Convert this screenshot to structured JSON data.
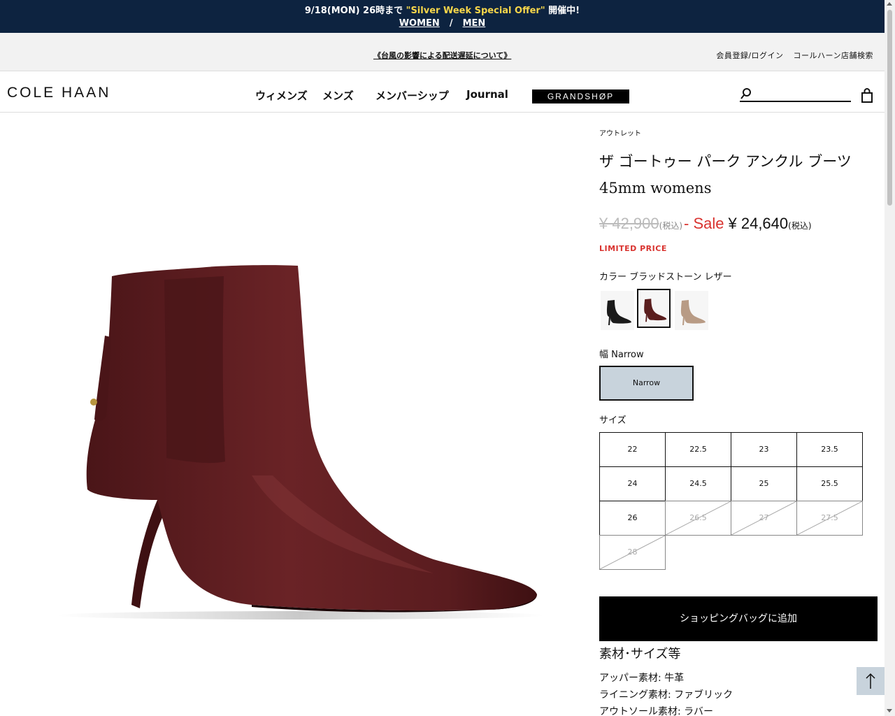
{
  "promo": {
    "line1_prefix": "9/18(MON) 26時まで ",
    "line1_highlight": "\"Silver Week Special Offer\"",
    "line1_suffix": " 開催中!",
    "women": "WOMEN",
    "separator": "/",
    "men": "MEN"
  },
  "notice": {
    "delivery_link": "《台風の影響による配送遅延について》",
    "login": "会員登録/ログイン",
    "store_search": "コールハーン店舗検索"
  },
  "header": {
    "logo": "COLE HAAN",
    "nav": [
      "ウィメンズ",
      "メンズ",
      "メンバーシップ",
      "Journal"
    ],
    "grandshop": "GRANDSHØP",
    "search_placeholder": ""
  },
  "product": {
    "category": "アウトレット",
    "title_line1": "ザ ゴートゥー パーク アンクル ブーツ",
    "title_line2": "45mm womens",
    "old_price": "¥ 42,900",
    "tax_label": "(税込)",
    "sale_label": "- Sale",
    "new_price": "¥ 24,640",
    "limited": "LIMITED PRICE",
    "color_label": "カラー ブラッドストーン レザー",
    "swatches": [
      {
        "name": "black",
        "color": "#1a1a1a",
        "selected": false
      },
      {
        "name": "bloodstone",
        "color": "#5a1e1e",
        "selected": true
      },
      {
        "name": "taupe",
        "color": "#b89b85",
        "selected": false
      }
    ],
    "width_label": "幅 Narrow",
    "width_option": "Narrow",
    "size_label": "サイズ",
    "sizes": [
      {
        "label": "22",
        "available": true
      },
      {
        "label": "22.5",
        "available": true
      },
      {
        "label": "23",
        "available": true
      },
      {
        "label": "23.5",
        "available": true
      },
      {
        "label": "24",
        "available": true
      },
      {
        "label": "24.5",
        "available": true
      },
      {
        "label": "25",
        "available": true
      },
      {
        "label": "25.5",
        "available": true
      },
      {
        "label": "26",
        "available": true
      },
      {
        "label": "26.5",
        "available": false
      },
      {
        "label": "27",
        "available": false
      },
      {
        "label": "27.5",
        "available": false
      },
      {
        "label": "28",
        "available": false
      }
    ],
    "add_to_bag": "ショッピングバッグに追加",
    "spec_title": "素材･サイズ等",
    "specs": [
      "アッパー素材: 牛革",
      "ライニング素材: ファブリック",
      "アウトソール素材: ラバー"
    ]
  },
  "colors": {
    "promo_bg": "#0d2340",
    "promo_highlight": "#f7d64a",
    "sale_red": "#d9332f",
    "boot": "#5a1e1e"
  }
}
